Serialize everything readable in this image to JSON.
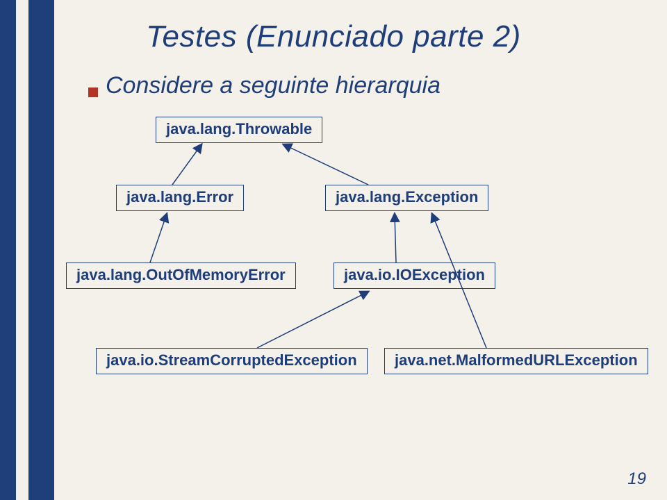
{
  "title": "Testes (Enunciado parte 2)",
  "intro": "Considere a seguinte hierarquia",
  "nodes": {
    "throwable": "java.lang.Throwable",
    "error": "java.lang.Error",
    "exception": "java.lang.Exception",
    "outofmemory": "java.lang.OutOfMemoryError",
    "ioexception": "java.io.IOException",
    "streamcorrupted": "java.io.StreamCorruptedException",
    "malformedurl": "java.net.MalformedURLException"
  },
  "page_number": "19"
}
